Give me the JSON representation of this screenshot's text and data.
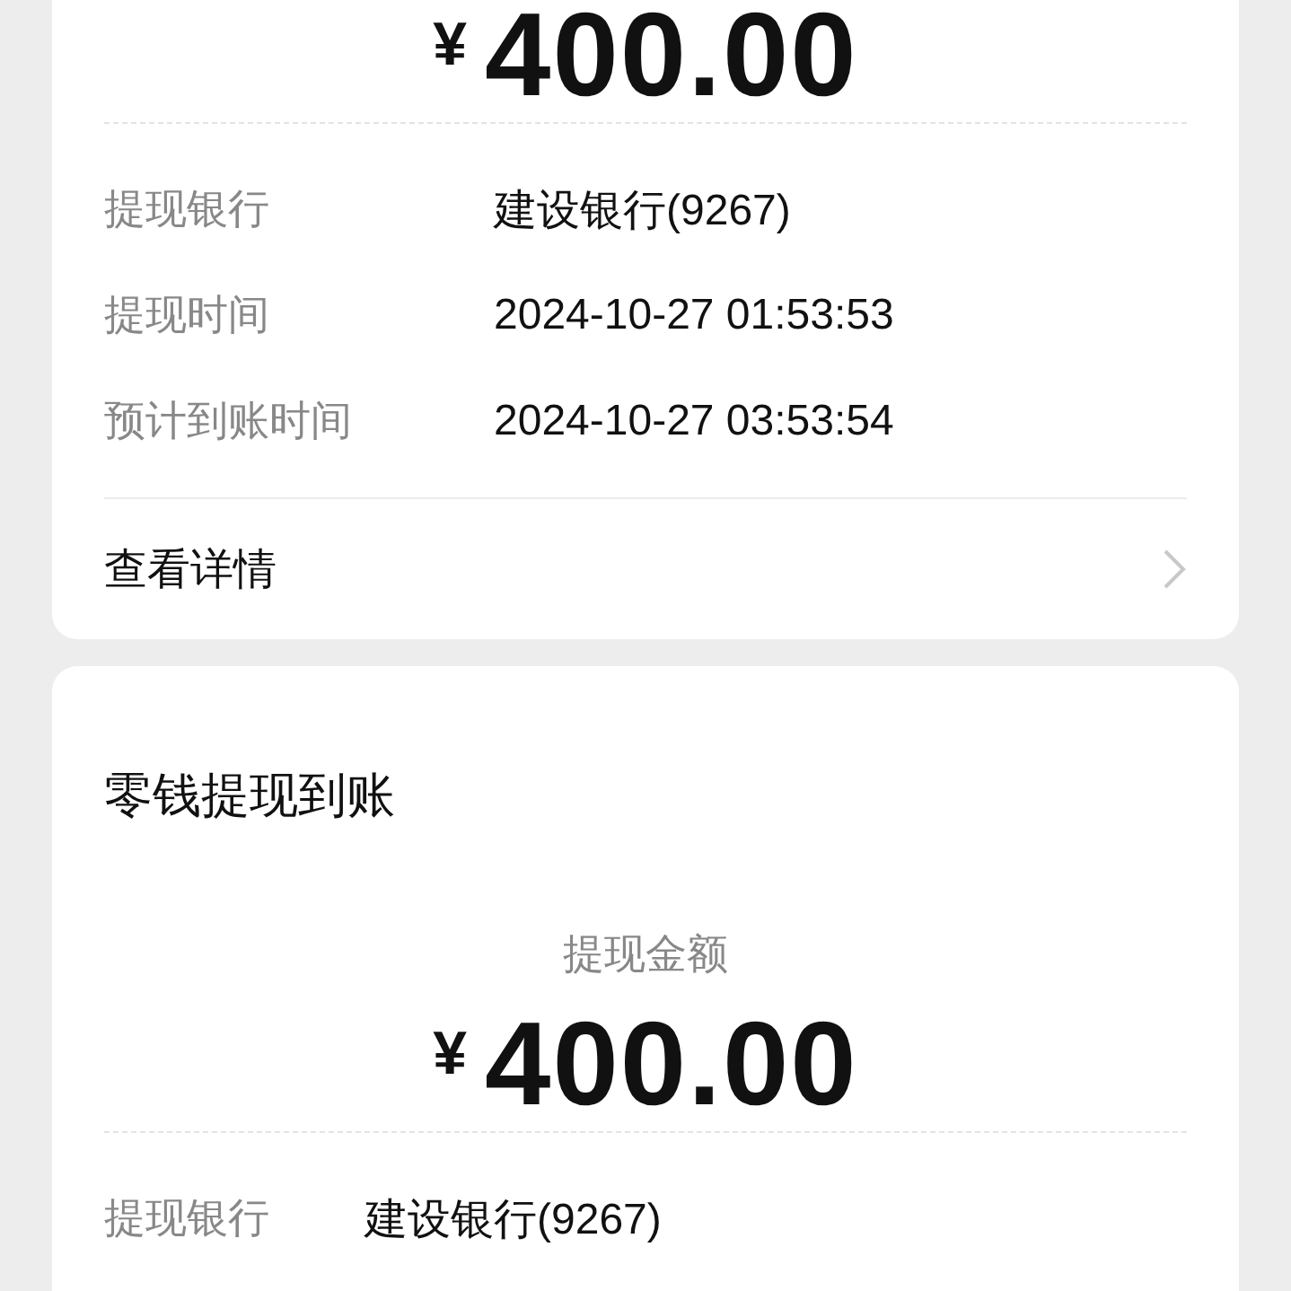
{
  "cards": [
    {
      "amount": {
        "currency": "¥",
        "value": "400.00"
      },
      "rows": [
        {
          "label": "提现银行",
          "value": "建设银行(9267)"
        },
        {
          "label": "提现时间",
          "value": "2024-10-27 01:53:53"
        },
        {
          "label": "预计到账时间",
          "value": "2024-10-27 03:53:54"
        }
      ],
      "link": {
        "label": "查看详情"
      }
    },
    {
      "title": "零钱提现到账",
      "amount_label": "提现金额",
      "amount": {
        "currency": "¥",
        "value": "400.00"
      },
      "rows": [
        {
          "label": "提现银行",
          "value": "建设银行(9267)"
        }
      ]
    }
  ]
}
